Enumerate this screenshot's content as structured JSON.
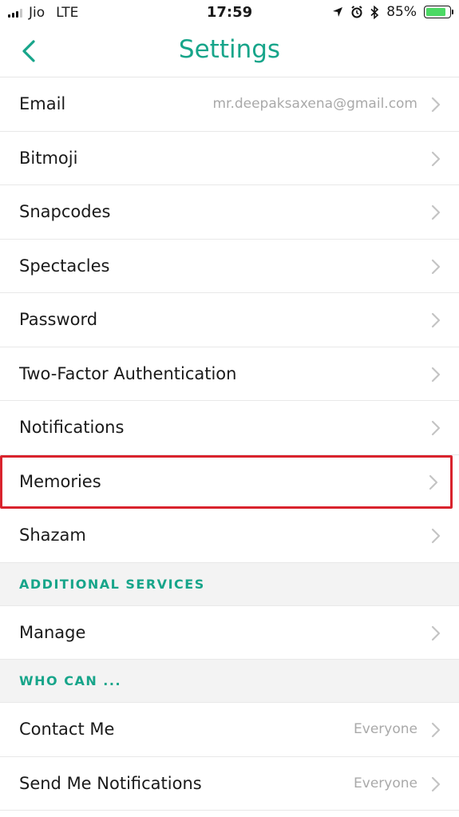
{
  "status_bar": {
    "carrier": "Jio",
    "network": "LTE",
    "time": "17:59",
    "battery_percent": "85%",
    "battery_level": 0.85,
    "battery_color": "#4cd964"
  },
  "header": {
    "title": "Settings",
    "back_icon": "chevron-left-icon",
    "accent_color": "#17a58a"
  },
  "rows_main": [
    {
      "label": "Email",
      "value": "mr.deepaksaxena@gmail.com"
    },
    {
      "label": "Bitmoji",
      "value": ""
    },
    {
      "label": "Snapcodes",
      "value": ""
    },
    {
      "label": "Spectacles",
      "value": ""
    },
    {
      "label": "Password",
      "value": ""
    },
    {
      "label": "Two-Factor Authentication",
      "value": ""
    },
    {
      "label": "Notifications",
      "value": ""
    },
    {
      "label": "Memories",
      "value": ""
    },
    {
      "label": "Shazam",
      "value": ""
    }
  ],
  "sections": {
    "additional_services": {
      "title": "ADDITIONAL SERVICES",
      "rows": [
        {
          "label": "Manage",
          "value": ""
        }
      ]
    },
    "who_can": {
      "title": "WHO CAN ...",
      "rows": [
        {
          "label": "Contact Me",
          "value": "Everyone"
        },
        {
          "label": "Send Me Notifications",
          "value": "Everyone"
        }
      ]
    }
  },
  "highlight_color": "#d9232d"
}
